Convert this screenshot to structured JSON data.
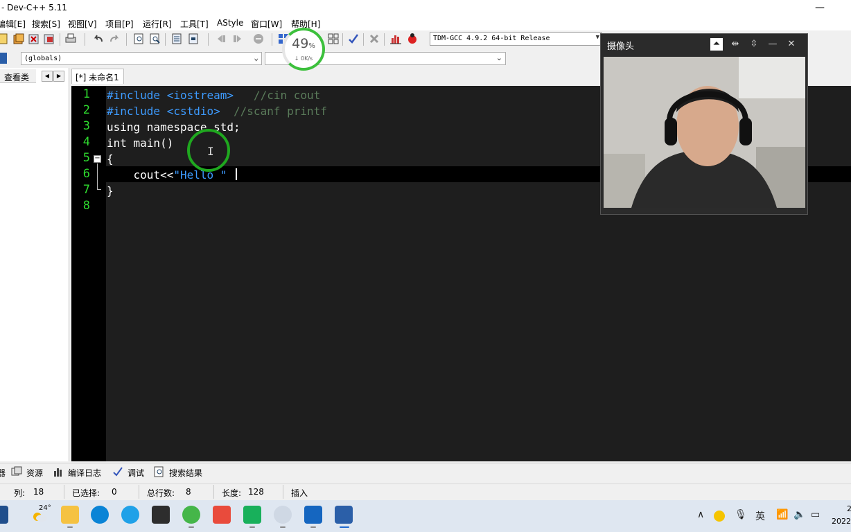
{
  "window": {
    "title": "- Dev-C++ 5.11",
    "minimize_glyph": "—"
  },
  "menu": [
    "编辑[E]",
    "搜索[S]",
    "视图[V]",
    "项目[P]",
    "运行[R]",
    "工具[T]",
    "AStyle",
    "窗口[W]",
    "帮助[H]"
  ],
  "toolbar": {
    "compiler": "TDM-GCC 4.9.2 64-bit Release",
    "scope": "(globals)",
    "icons": [
      "new-file-icon",
      "save-all-icon",
      "close-icon",
      "close-all-icon",
      "print-icon",
      "undo-icon",
      "redo-icon",
      "find-icon",
      "replace-icon",
      "goto-icon",
      "bookmark-icon",
      "indent-icon",
      "unindent-icon",
      "toggle-comment-icon",
      "compile-icon",
      "run-icon",
      "compile-run-icon",
      "rebuild-icon",
      "check-icon",
      "stop-icon",
      "chart-icon",
      "debug-icon"
    ]
  },
  "speed_widget": {
    "percent": "49",
    "percent_sign": "%",
    "rate": "↓ 0K/s"
  },
  "left_panel": {
    "tab": "查看类",
    "prev": "◀",
    "next": "▶"
  },
  "editor": {
    "tab": "[*] 未命名1",
    "lines": [
      {
        "n": "1",
        "parts": [
          [
            "inc",
            "#include <iostream>"
          ],
          [
            "cmt",
            "   //cin cout"
          ]
        ]
      },
      {
        "n": "2",
        "parts": [
          [
            "inc",
            "#include <cstdio>"
          ],
          [
            "cmt",
            "  //scanf printf"
          ]
        ]
      },
      {
        "n": "3",
        "parts": [
          [
            "plain",
            "using namespace std;"
          ]
        ]
      },
      {
        "n": "4",
        "parts": [
          [
            "plain",
            "int main()"
          ]
        ]
      },
      {
        "n": "5",
        "parts": [
          [
            "plain",
            "{"
          ]
        ]
      },
      {
        "n": "6",
        "parts": [
          [
            "plain",
            "    cout<<"
          ],
          [
            "str",
            "\"Hello \""
          ]
        ]
      },
      {
        "n": "7",
        "parts": [
          [
            "plain",
            "}"
          ]
        ]
      },
      {
        "n": "8",
        "parts": []
      }
    ]
  },
  "camera": {
    "title": "摄像头",
    "controls": [
      "pin-top-icon",
      "flip-horizontal-icon",
      "flip-vertical-icon",
      "minimize-icon",
      "close-icon"
    ]
  },
  "bottom_tabs": [
    "器",
    "资源",
    "编译日志",
    "调试",
    "搜索结果"
  ],
  "status": {
    "col_label": "列:",
    "col": "18",
    "sel_label": "已选择:",
    "sel": "0",
    "lines_label": "总行数:",
    "lines": "8",
    "len_label": "长度:",
    "len": "128",
    "mode": "插入"
  },
  "taskbar": {
    "weather": "24°",
    "ime": "英",
    "clock_fragment": "2022",
    "clock_top": "2"
  },
  "colors": {
    "editor_bg": "#1e1e1e",
    "line_numbers": "#2fdb2f",
    "include": "#3d9bff",
    "comment": "#5a7b5a",
    "accent_ring": "#1fa81f"
  }
}
